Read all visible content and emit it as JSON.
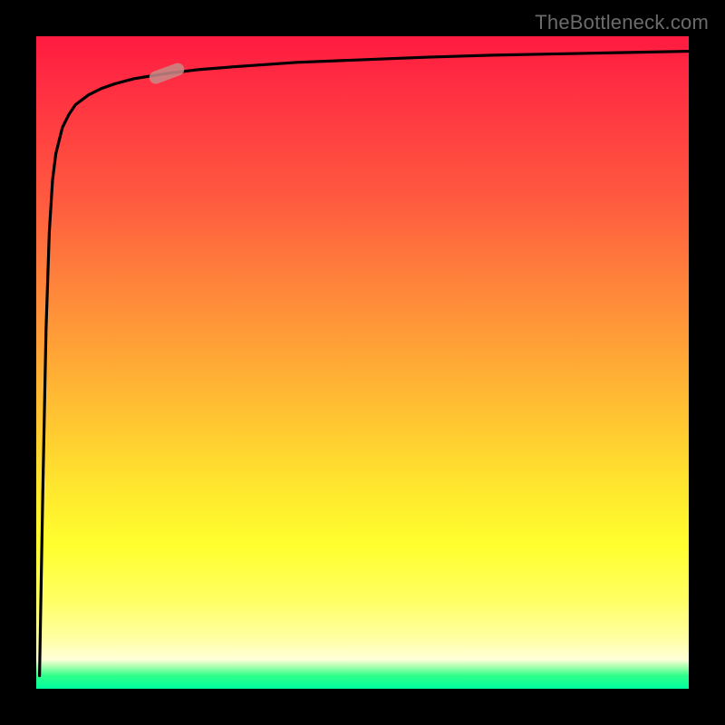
{
  "watermark": "TheBottleneck.com",
  "colors": {
    "background": "#000000",
    "gradient_top": "#ff1a3f",
    "gradient_mid1": "#ff8a3a",
    "gradient_mid2": "#ffff2e",
    "gradient_bottom": "#00ffa0",
    "curve": "#000000",
    "marker": "#c88a86"
  },
  "chart_data": {
    "type": "line",
    "title": "",
    "xlabel": "",
    "ylabel": "",
    "xlim": [
      0,
      100
    ],
    "ylim": [
      0,
      100
    ],
    "grid": false,
    "legend": false,
    "series": [
      {
        "name": "bottleneck-curve",
        "x": [
          0.5,
          1,
          1.5,
          2,
          2.5,
          3,
          4,
          5,
          6,
          8,
          10,
          12,
          15,
          20,
          25,
          30,
          40,
          50,
          60,
          70,
          80,
          90,
          100
        ],
        "values": [
          2,
          30,
          55,
          70,
          78,
          82,
          86,
          88,
          89.5,
          91,
          92,
          92.7,
          93.5,
          94.3,
          94.9,
          95.3,
          96.0,
          96.4,
          96.8,
          97.1,
          97.3,
          97.5,
          97.7
        ]
      }
    ],
    "marker": {
      "series": "bottleneck-curve",
      "x": 20,
      "y": 94.3,
      "shape": "rounded-bar",
      "angle_deg": 20
    },
    "annotations": [
      {
        "text": "TheBottleneck.com",
        "position": "top-right"
      }
    ]
  }
}
